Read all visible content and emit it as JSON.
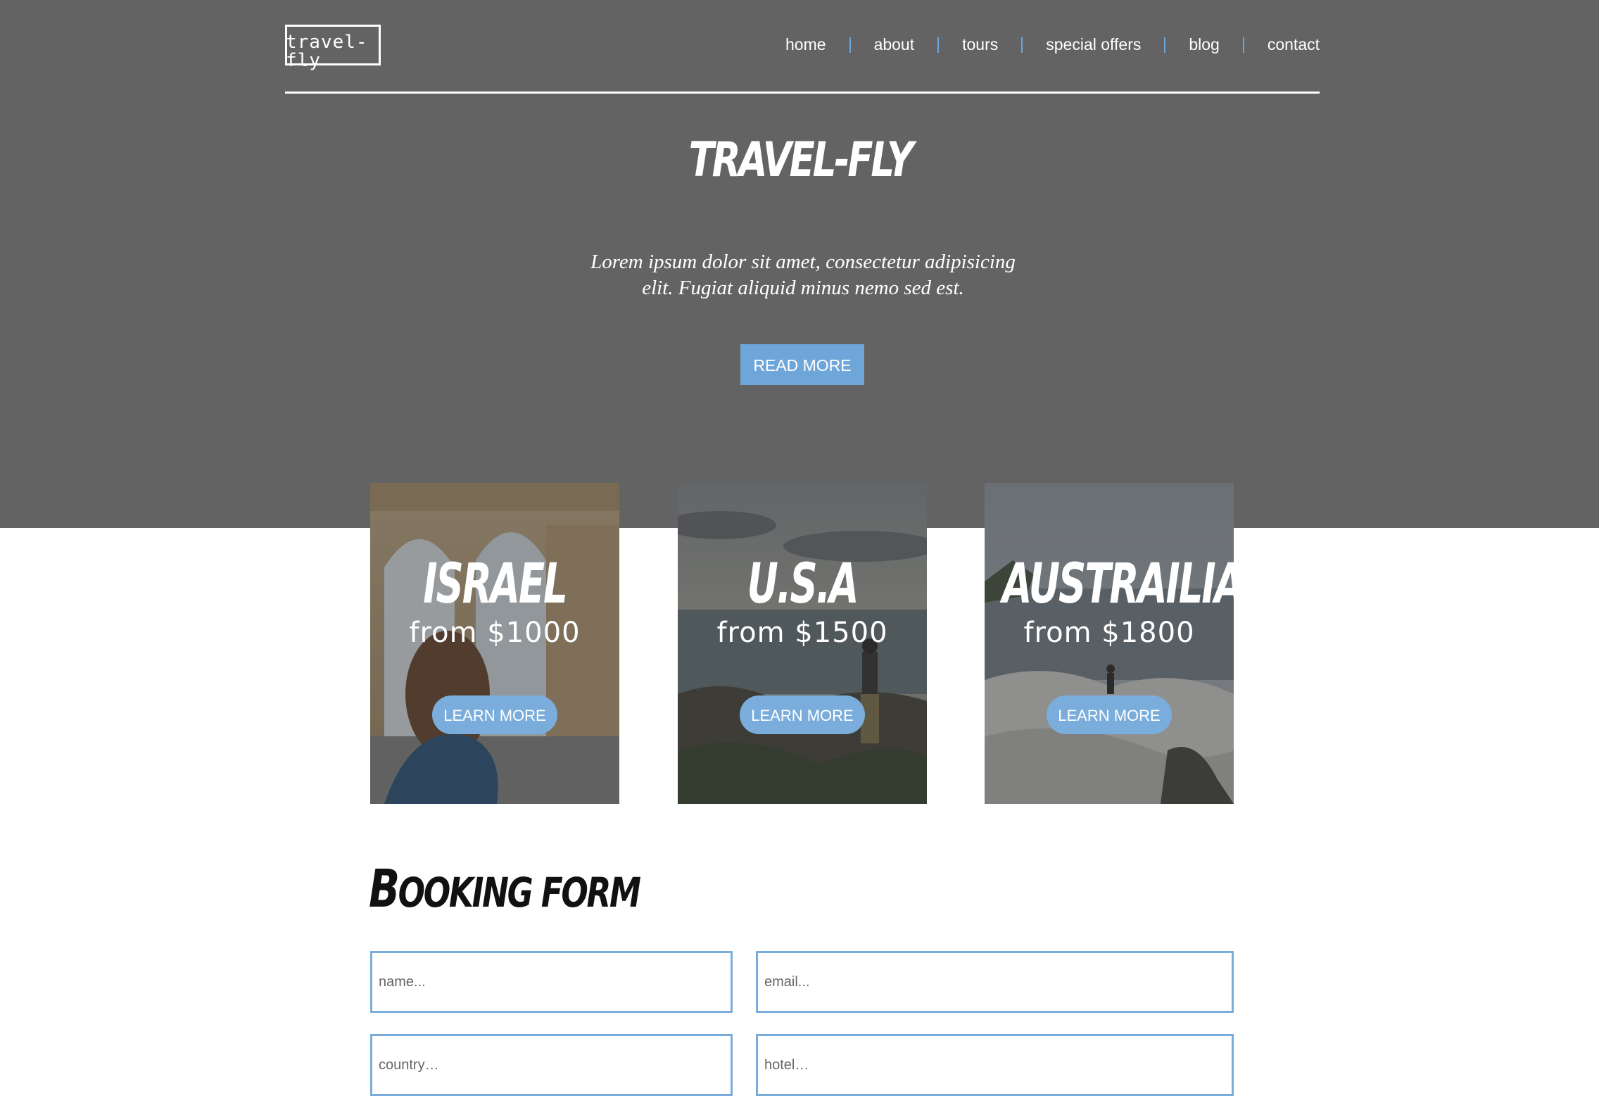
{
  "header": {
    "logo": "travel-fly",
    "nav": [
      {
        "label": "home"
      },
      {
        "label": "about"
      },
      {
        "label": "tours"
      },
      {
        "label": "special offers"
      },
      {
        "label": "blog"
      },
      {
        "label": "contact"
      }
    ]
  },
  "hero": {
    "title": "TRAVEL-FLY",
    "text": "Lorem ipsum dolor sit amet, consectetur adipisicing elit. Fugiat aliquid minus nemo sed est.",
    "button": "READ MORE"
  },
  "tours": [
    {
      "country": "ISRAEL",
      "price": "from $1000",
      "button": "LEARN MORE",
      "photo_icon": "arches-photo"
    },
    {
      "country": "U.S.A",
      "price": "from $1500",
      "button": "LEARN MORE",
      "photo_icon": "coast-photo"
    },
    {
      "country": "AUSTRAILIA",
      "price": "from $1800",
      "button": "LEARN MORE",
      "photo_icon": "rocky-shore-photo"
    }
  ],
  "booking": {
    "title_first": "B",
    "title_rest": "OOKING FORM",
    "fields": {
      "name": "name...",
      "email": "email...",
      "country": "country…",
      "hotel": "hotel…"
    }
  },
  "colors": {
    "hero_bg": "#636363",
    "accent": "#6fa6d9",
    "page_bg": "#ffffff"
  }
}
